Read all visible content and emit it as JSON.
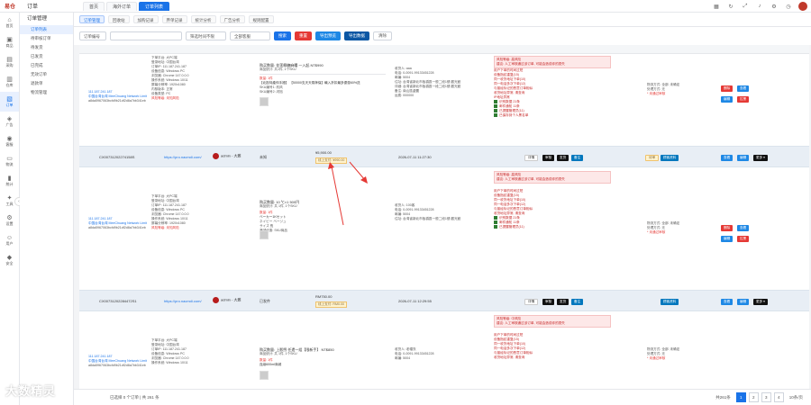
{
  "app": {
    "logo_text": "易仓",
    "section": "订单"
  },
  "top_tabs": [
    {
      "label": "首页",
      "active": false
    },
    {
      "label": "海外订单",
      "active": false
    },
    {
      "label": "订单列表",
      "active": true
    }
  ],
  "top_icons": [
    "grid-icon",
    "refresh-icon",
    "fullscreen-icon",
    "bell-icon",
    "settings-icon",
    "clock-icon",
    "user-icon"
  ],
  "left_nav": [
    {
      "label": "首页",
      "icon": "home-icon"
    },
    {
      "label": "商品",
      "icon": "box-icon"
    },
    {
      "label": "采购",
      "icon": "cart-icon"
    },
    {
      "label": "仓库",
      "icon": "warehouse-icon"
    },
    {
      "label": "订单",
      "icon": "order-icon",
      "active": true
    },
    {
      "label": "广告",
      "icon": "megaphone-icon"
    },
    {
      "label": "客服",
      "icon": "headset-icon"
    },
    {
      "label": "物流",
      "icon": "truck-icon"
    },
    {
      "label": "统计",
      "icon": "chart-icon"
    },
    {
      "label": "工具",
      "icon": "tool-icon"
    },
    {
      "label": "设置",
      "icon": "gear-icon"
    },
    {
      "label": "用户",
      "icon": "person-icon"
    },
    {
      "label": "安全",
      "icon": "shield-icon"
    }
  ],
  "sub_nav": {
    "title": "订单管理",
    "items": [
      {
        "label": "订单列表",
        "active": true
      },
      {
        "label": "待审核订单"
      },
      {
        "label": "待发货"
      },
      {
        "label": "已发货"
      },
      {
        "label": "已完成"
      },
      {
        "label": "无效订单"
      },
      {
        "label": "退款单"
      },
      {
        "label": "物流管理"
      }
    ]
  },
  "sub_tabs": [
    {
      "label": "订单管理",
      "active": true
    },
    {
      "label": "回收站"
    },
    {
      "label": "加购记录"
    },
    {
      "label": "弃单记录"
    },
    {
      "label": "统计分析"
    },
    {
      "label": "广告分析"
    },
    {
      "label": "规则配置"
    }
  ],
  "filters": {
    "field_select": "订单编号",
    "time_select": "筛选时间不限",
    "seller_select": "全部客服",
    "search_label": "搜索",
    "reset_label": "重置",
    "export_label": "导出预览",
    "more_export_label": "导出数据",
    "clear_label": "清除"
  },
  "blocks": [
    {
      "device_info": [
        "下单平台: 大PC端",
        "登录地址: 中国台湾",
        "订单IP: 111.187.241.187",
        "设备信息: Windows PC",
        "浏览器: Chrome 147.0.0.0",
        "操作系统: Windows 10/11",
        "屏幕分辨率: 1920x1080",
        "内核版本: 正常",
        "设备类型: PC",
        "风险等级: 未知风险"
      ],
      "ip": "111.187.241.187",
      "ip_org": "中国台湾台湾 MeeChuang Network Limit",
      "session": "a8da5967063bcfd9b21df2d8a7bb341eb",
      "product_total": "购买数量: 花莲椰糖麻糬 一入起 NT$990",
      "stat": "商品统计: 共1件, 1个SKU",
      "product_flag": "数量: 1件",
      "product_name": "【北投特產伴手禮】 【50000支天天祭拜保】輸入折扣最多優惠60%送",
      "sku1": "SKU编号1: 豹风",
      "sku2": "SKU编号2: 闪铛",
      "address": [
        "收货人: aaa",
        "电话: 0-0091-99133451228",
        "邮编: 5004",
        "住址: 台湾省新北市板橋區一般二段1號.觀光館",
        "详细: 台湾省新北市板橋區一段二段1號.觀光館",
        "备注: 南山區處置",
        "运费: 000000"
      ],
      "risk_title": "风险等级: 高风险",
      "risk_tip": "建议: 人工审核通过该订单, 可能会造成你的损失",
      "risk_lines": [
        "用户下单的时间过短",
        "设备指纹重复(15)",
        "同一收货地址下单(10)",
        "同一电话多次下单(12)",
        "与曾经标记的恶意订单相似",
        "收货地址异常, 请查询",
        "IP地址异常"
      ],
      "risk_ok": [
        "识别数据 21条",
        "邮件通知 11条",
        "已提醒管理员(11)",
        "已保存到个人黑名单"
      ],
      "log_time": "物流方式: 全部: 未确定",
      "log2": "处理方式: 无",
      "log3": "* 未通过审核"
    }
  ],
  "order_rows": [
    {
      "id": "CX00731202274158S",
      "site": "https://pro.nacmdi.com/",
      "seller": "admin - 大雅",
      "buyer": "未知",
      "amount": "¥5,900.00",
      "tag": "线上支付: ¥990.00",
      "time": "2026-07-11 11:27:30"
    },
    {
      "id": "CX00731202284472S1",
      "site": "https://pro.nacmdi.com/",
      "seller": "admin - 大雅",
      "buyer": "已发件",
      "amount": "RM750.00",
      "tag": "线上支付: RM0.00",
      "time": "2026-07-11 12:29:55"
    }
  ],
  "block2": {
    "product_total": "购买数量: 10 ℃×1 500円",
    "stat": "商品统计: 共 1件, 1个SKU",
    "product_flag": "数量: 1件",
    "product_name": "ベーカー1Kセット",
    "size": "ネイビー ベージュ",
    "sku": "サイズ 長",
    "promo_note": "满减优惠: SKU商品",
    "address_name": "收货人: 100客",
    "risk_title": "风险等级: 高风险",
    "risk_tip": "建议: 人工审核通过该订单, 可能会造成你的损失"
  },
  "block3": {
    "product_total": "购买数量: 上影煦 任遗一组【限新手】 NT$850",
    "stat": "商品统计: 共 1件, 1个SKU",
    "product_flag": "数量: 1件",
    "product_name": "连续600ml商城",
    "address_name": "收货人: 老帽衣",
    "risk_title": "风险等级: 中风险",
    "risk_tip": "建议: 人工审核通过该订单, 可能会造成你的损失"
  },
  "pagination": {
    "total_text": "共261条",
    "pages": [
      "1",
      "2",
      "3",
      "4"
    ],
    "current": "1",
    "per_page": "10条/页"
  },
  "footer": {
    "summary": "已选择 0 个订单 | 共 261 条"
  },
  "watermark": "大数精灵",
  "colors": {
    "accent": "#1a73e8",
    "danger": "#e53935",
    "row_highlight": "#e8eef5"
  }
}
